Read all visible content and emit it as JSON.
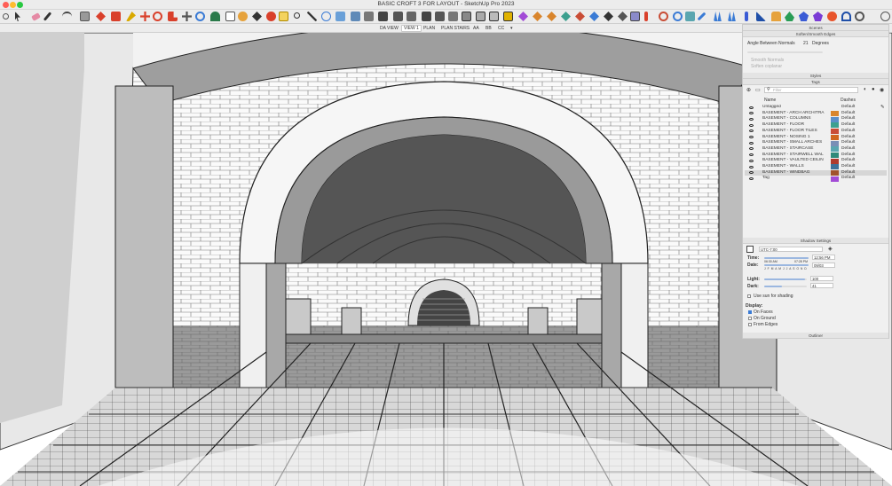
{
  "window": {
    "title": "BASIC CROFT 3 FOR LAYOUT - SketchUp Pro 2023"
  },
  "toolbar": {
    "icons": [
      "search-icon",
      "select-icon",
      "eraser-icon",
      "pencil-icon",
      "line-icon",
      "arc-icon",
      "shape-icon",
      "pushpull-icon",
      "follow-me-icon",
      "paint-icon",
      "move-icon",
      "rotate-icon",
      "scale-icon",
      "orbit-icon",
      "pan-icon",
      "zoom-icon",
      "zoom-extents-icon",
      "tape-icon",
      "text-icon",
      "section-icon",
      "warehouse-icon",
      "extension-icon",
      "sandbox-icon"
    ]
  },
  "scenes": {
    "tabs": [
      "DA VIEW",
      "VIEW 1",
      "PLAN",
      "PLAN STAIRS",
      "AA",
      "BB",
      "CC"
    ],
    "active_index": 1
  },
  "tray": {
    "scenes_header": "Scenes",
    "soften": {
      "header": "Soften/Smooth Edges",
      "angle_label": "Angle Between Normals",
      "angle_value": "21",
      "angle_unit": "Degrees",
      "smooth_normals": "Smooth Normals",
      "soften_coplanar": "Soften coplanar"
    },
    "styles_header": "Styles",
    "tags": {
      "header": "Tags",
      "filter_placeholder": "Filter",
      "col_name": "Name",
      "col_dashes": "Dashes",
      "rows": [
        {
          "name": "Untagged",
          "color": "",
          "dashes": "Default"
        },
        {
          "name": "BASEMENT - ARCH ARCHITRA",
          "color": "#d9852c",
          "dashes": "Default"
        },
        {
          "name": "BASEMENT - COLUMNS",
          "color": "#5b8fc9",
          "dashes": "Default"
        },
        {
          "name": "BASEMENT - FLOOR",
          "color": "#3da08f",
          "dashes": "Default"
        },
        {
          "name": "BASEMENT - FLOOR TILES",
          "color": "#c94d36",
          "dashes": "Default"
        },
        {
          "name": "BASEMENT - NOSING 1",
          "color": "#d0661e",
          "dashes": "Default"
        },
        {
          "name": "BASEMENT - SMALL ARCHES",
          "color": "#7a8fb6",
          "dashes": "Default"
        },
        {
          "name": "BASEMENT - STAIRCASE",
          "color": "#5aa6b0",
          "dashes": "Default"
        },
        {
          "name": "BASEMENT - STAIRWELL WAL",
          "color": "#2f8a7a",
          "dashes": "Default"
        },
        {
          "name": "BASEMENT - VAULTED CEILIN",
          "color": "#b03a2e",
          "dashes": "Default"
        },
        {
          "name": "BASEMENT - WALLS",
          "color": "#3f6f99",
          "dashes": "Default"
        },
        {
          "name": "BASEMENT - WINDBAG",
          "color": "#a0522d",
          "dashes": "Default"
        },
        {
          "name": "Tag",
          "color": "#a24bd6",
          "dashes": "Default"
        }
      ]
    },
    "shadows": {
      "header": "Shadow Settings",
      "timezone": "UTC-7:00",
      "time_label": "Time:",
      "time_start": "06:30 AM",
      "time_mid": "12:00 PM",
      "time_end": "07:28 PM",
      "time_value": "12:56 PM",
      "date_label": "Date:",
      "date_ticks": "J F M A M J J A S O N D",
      "date_value": "09/03",
      "light_label": "Light:",
      "light_value": "100",
      "light_fraction": 0.95,
      "dark_label": "Dark:",
      "dark_value": "41",
      "dark_fraction": 0.41,
      "use_sun": "Use sun for shading",
      "display_label": "Display:",
      "on_faces": "On Faces",
      "on_ground": "On Ground",
      "from_edges": "From Edges"
    },
    "outliner_header": "Outliner"
  }
}
